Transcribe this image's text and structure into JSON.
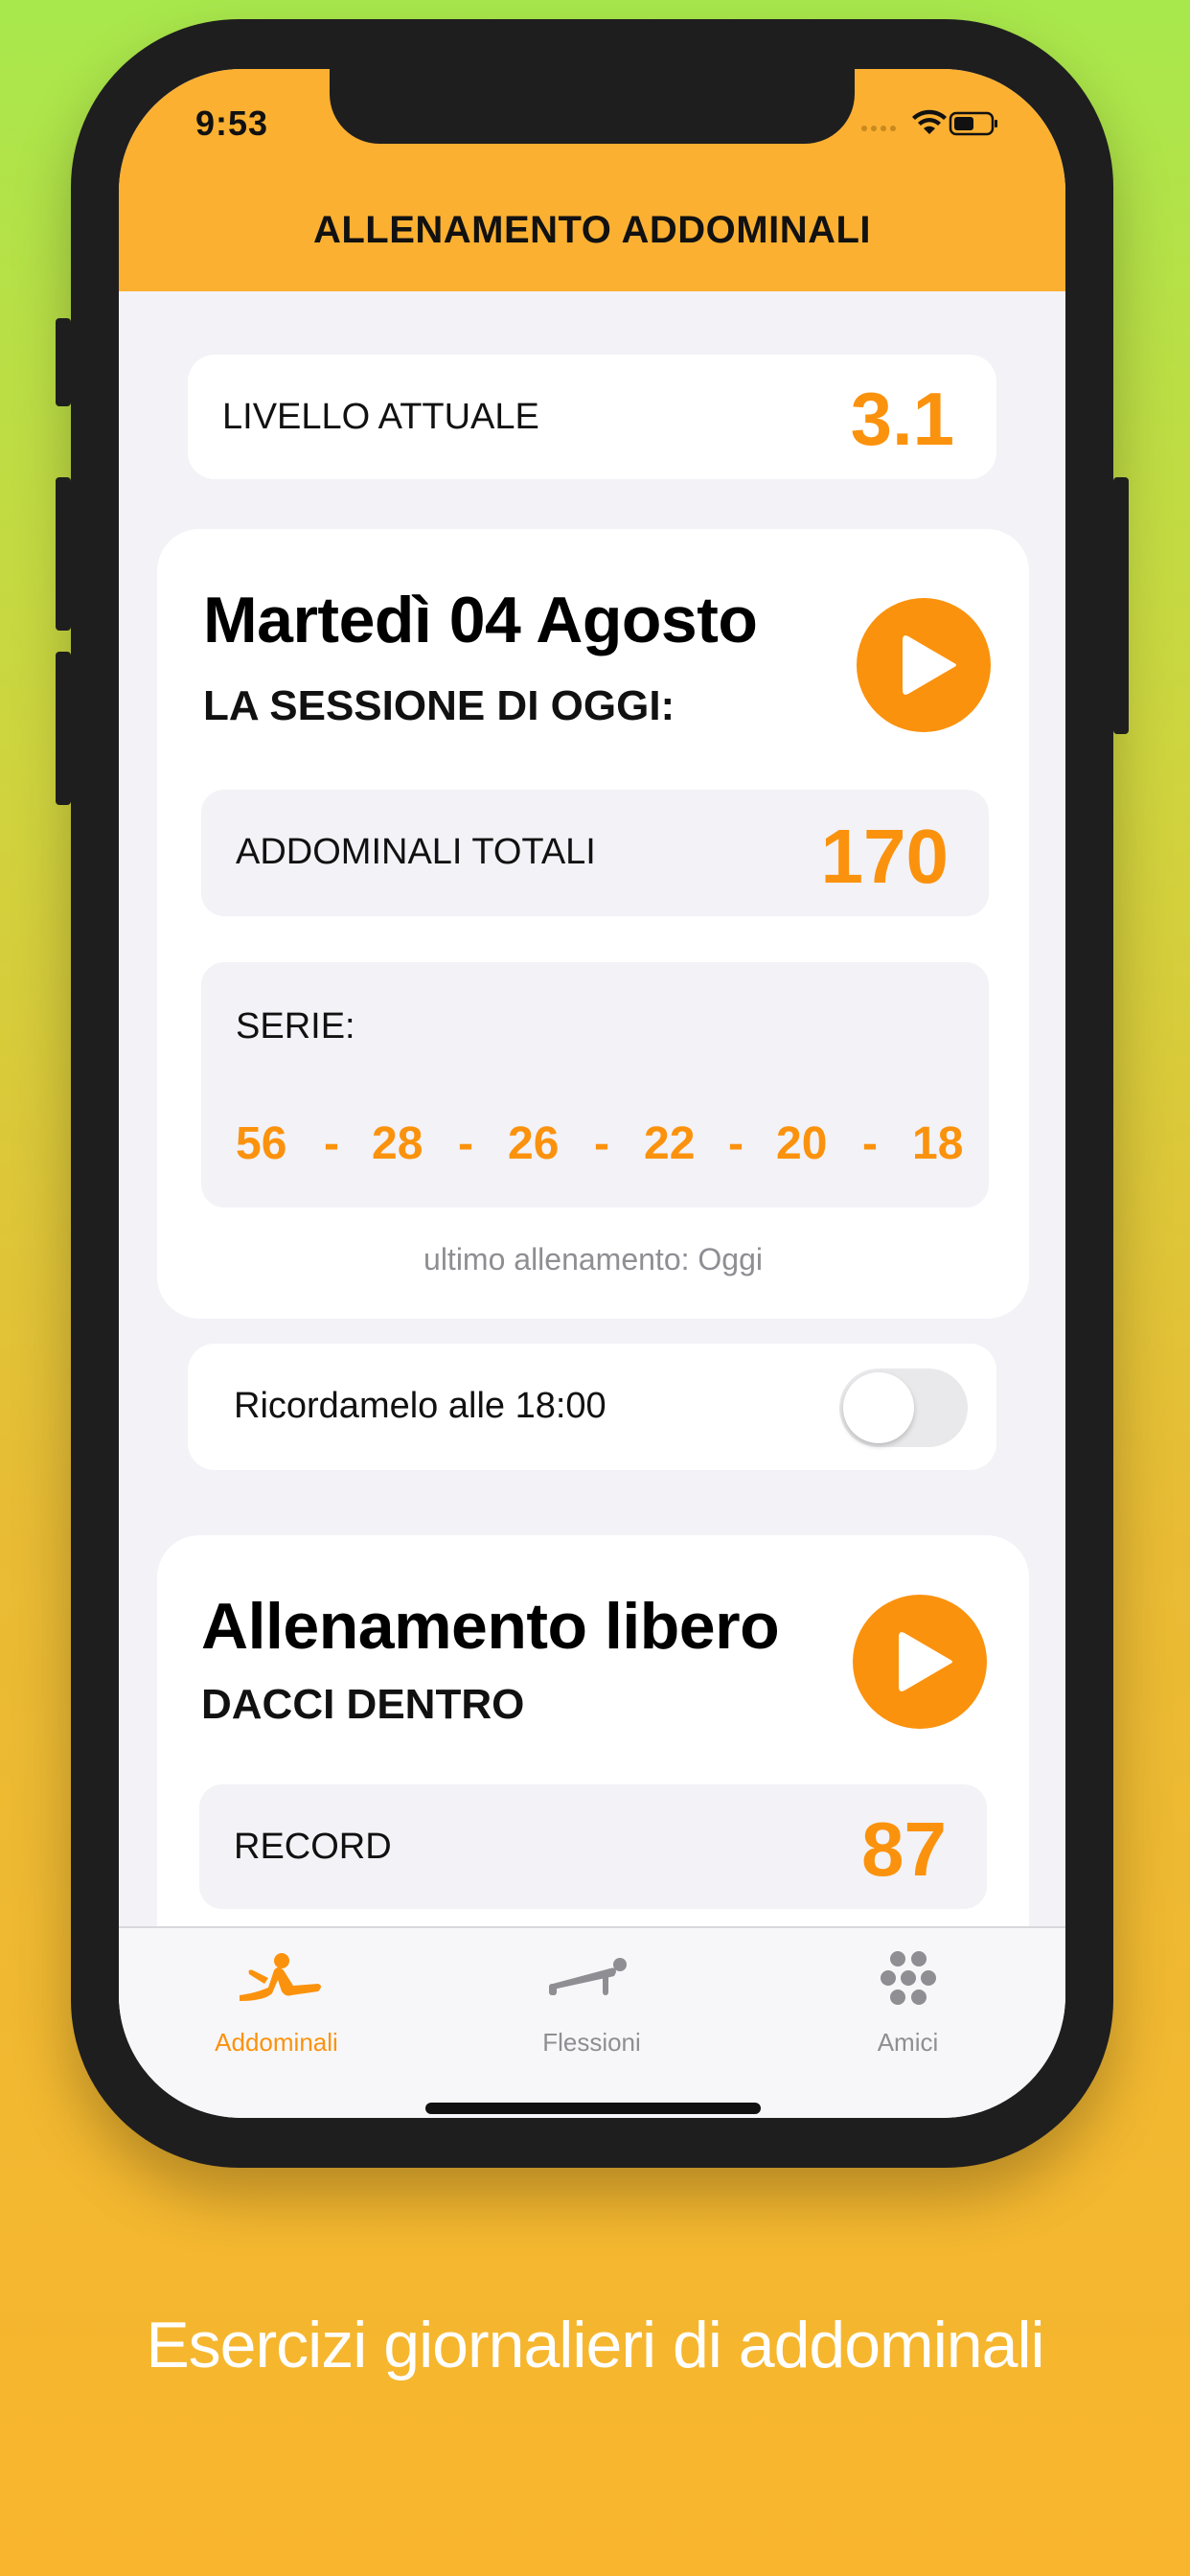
{
  "status": {
    "time": "9:53"
  },
  "header": {
    "title": "ALLENAMENTO ADDOMINALI"
  },
  "level": {
    "label": "LIVELLO ATTUALE",
    "value": "3.1"
  },
  "session": {
    "date": "Martedì 04 Agosto",
    "subtitle": "LA SESSIONE DI OGGI:",
    "total_label": "ADDOMINALI TOTALI",
    "total_value": "170",
    "series_label": "SERIE:",
    "series": [
      "56",
      "28",
      "26",
      "22",
      "20",
      "18"
    ],
    "series_separator": "-",
    "last_training": "ultimo allenamento: Oggi"
  },
  "reminder": {
    "label": "Ricordamelo alle 18:00",
    "enabled": false
  },
  "free": {
    "title": "Allenamento libero",
    "subtitle": "DACCI DENTRO",
    "record_label": "RECORD",
    "record_value": "87"
  },
  "tabs": [
    {
      "label": "Addominali",
      "icon": "situp-icon",
      "active": true
    },
    {
      "label": "Flessioni",
      "icon": "pushup-icon",
      "active": false
    },
    {
      "label": "Amici",
      "icon": "friends-icon",
      "active": false
    }
  ],
  "caption": "Esercizi giornalieri di addominali",
  "colors": {
    "accent": "#fb920d",
    "header": "#fbb031",
    "inactive": "#8e8e93"
  }
}
